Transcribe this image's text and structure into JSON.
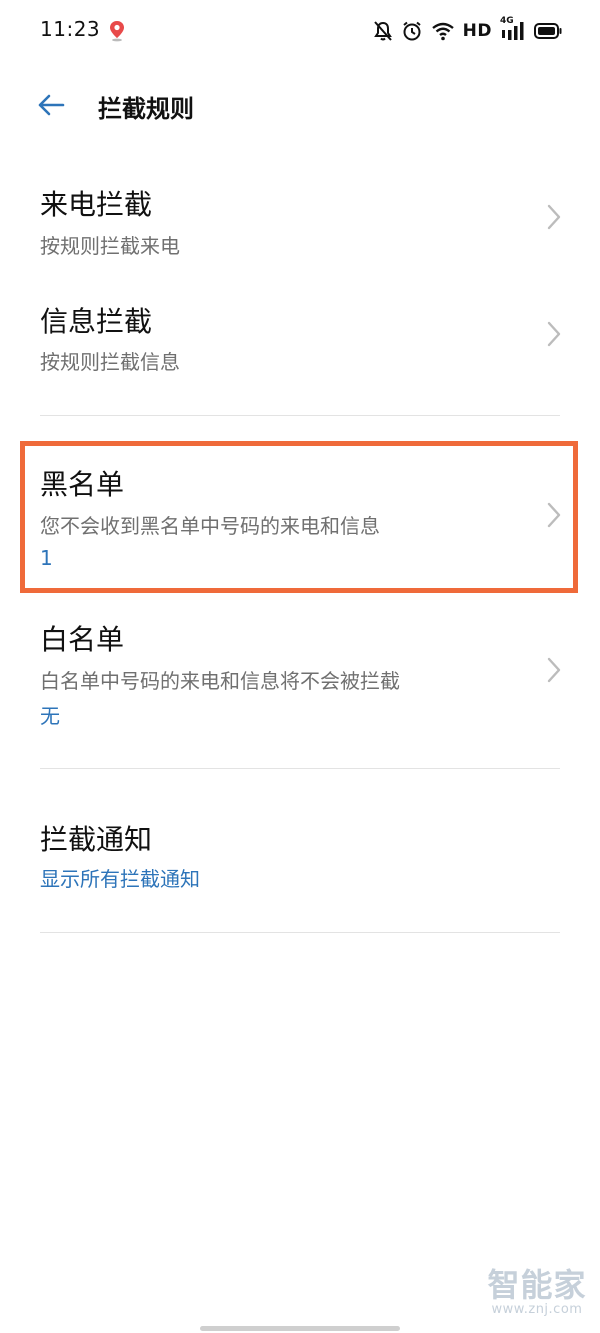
{
  "status_bar": {
    "time": "11:23",
    "network_label": "HD",
    "network_type": "4G",
    "icons": [
      "location-pin-icon",
      "mute-bell-icon",
      "alarm-clock-icon",
      "wifi-icon",
      "cell-signal-icon",
      "battery-icon"
    ]
  },
  "app_bar": {
    "title": "拦截规则",
    "back_icon": "arrow-left-icon"
  },
  "rows": {
    "call_block": {
      "title": "来电拦截",
      "subtitle": "按规则拦截来电"
    },
    "message_block": {
      "title": "信息拦截",
      "subtitle": "按规则拦截信息"
    },
    "blacklist": {
      "title": "黑名单",
      "subtitle": "您不会收到黑名单中号码的来电和信息",
      "value": "1"
    },
    "whitelist": {
      "title": "白名单",
      "subtitle": "白名单中号码的来电和信息将不会被拦截",
      "value": "无"
    },
    "block_notification": {
      "title": "拦截通知",
      "value": "显示所有拦截通知"
    }
  },
  "watermark": {
    "brand": "智能家",
    "url": "www.znj.com"
  },
  "colors": {
    "accent_blue": "#2d74b9",
    "highlight_border": "#ef6a3a",
    "divider": "#e3e3e3",
    "subtitle_gray": "#707070"
  }
}
